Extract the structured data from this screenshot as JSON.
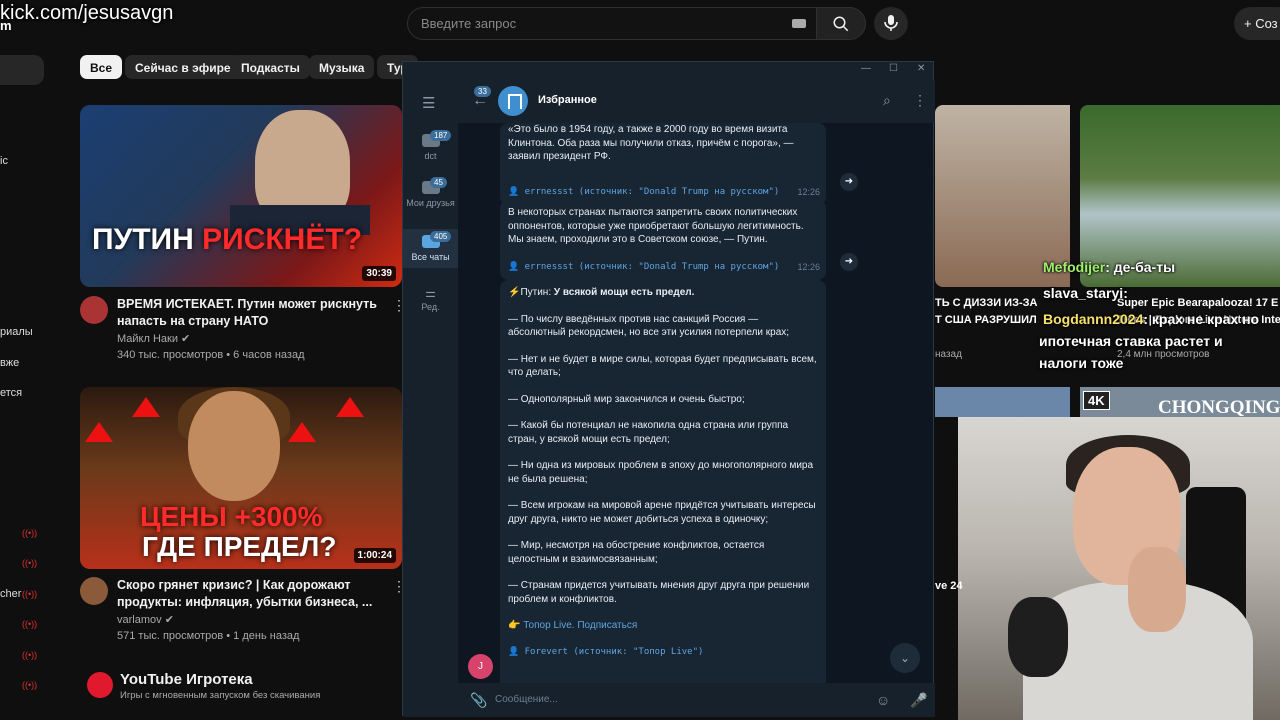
{
  "stream": {
    "url": "kick.com/jesusavgn",
    "url_cut": "m"
  },
  "youtube": {
    "search_placeholder": "Введите запрос",
    "create_label": "+ Соз",
    "chips": [
      "Все",
      "Сейчас в эфире",
      "Подкасты",
      "Музыка",
      "Тур"
    ],
    "sidebar_texts": [
      "ic",
      "риалы",
      "вже",
      "ется",
      "cher"
    ],
    "videos": [
      {
        "thumb_line1": "ПУТИН ",
        "thumb_line1_red": "РИСКНЁТ?",
        "duration": "30:39",
        "title": "ВРЕМЯ ИСТЕКАЕТ. Путин может рискнуть напасть на страну НАТО",
        "channel": "Майкл Наки",
        "meta": "340 тыс. просмотров • 6 часов назад"
      },
      {
        "thumb_line1_red": "ЦЕНЫ +300%",
        "thumb_line2": "ГДЕ ПРЕДЕЛ?",
        "duration": "1:00:24",
        "title": "Скоро грянет кризис? | Как дорожают продукты: инфляция, убытки бизнеса, ...",
        "channel": "varlamov",
        "meta": "571 тыс. просмотров • 1 день назад"
      }
    ],
    "right_cards": {
      "title_a": "ТЬ С ДИЗЗИ ИЗ-ЗА",
      "title_b": "Т США РАЗРУШИЛ",
      "meta_a": "назад",
      "title_c": "Super Epic Bearapalooza! 17 E",
      "title_d": "Trees | Explore Live Nature Inter",
      "meta_c": "2,4 млн просмотров",
      "caption_e": "ve 24",
      "badge": "4K",
      "caption_f": "CHONGQING"
    },
    "gamehub_title": "YouTube Игротека",
    "gamehub_sub": "Игры с мгновенным запуском без скачивания"
  },
  "chat_overlay": [
    {
      "user": "Mefodijer",
      "text": ": де-ба-ты"
    },
    {
      "user": "slava_staryi",
      "text": ":"
    },
    {
      "user": "Bogdannn2024",
      "text": ": крах не крах но"
    },
    {
      "user": "",
      "text": "ипотечная ставка растет и"
    },
    {
      "user": "",
      "text": "налоги тоже"
    }
  ],
  "telegram": {
    "chat_title": "Избранное",
    "unread_back": "33",
    "folders": [
      {
        "label": "dct",
        "badge": "187"
      },
      {
        "label": "Мои друзья",
        "badge": "45"
      },
      {
        "label": "Все чаты",
        "badge": "405"
      },
      {
        "label": "Ред.",
        "badge": ""
      }
    ],
    "msg1": {
      "text": "«Это было в 1954 году, а также в 2000 году во время визита Клинтона. Оба раза мы получили отказ, причём с порога», — заявил президент РФ.",
      "source": "👤 errnessst (источник: \"Donald Trump на русском\")",
      "time": "12:26"
    },
    "msg2": {
      "text": "В некоторых странах пытаются запретить своих политических оппонентов, которые уже приобретают большую легитимность. Мы знаем, проходили это в Советском союзе, — Путин.",
      "source": "👤 errnessst (источник: \"Donald Trump на русском\")",
      "time": "12:26"
    },
    "msg3": {
      "lead_icon": "⚡",
      "lead_prefix": "Путин: ",
      "lead_bold": "У всякой мощи есть предел.",
      "paragraphs": [
        "— По числу введённых против нас санкций Россия — абсолютный рекордсмен, но все эти усилия потерпели крах;",
        "— Нет и не будет в мире силы, которая будет предписывать всем, что делать;",
        "— Однополярный мир закончился и очень быстро;",
        "— Какой бы потенциал не накопила одна страна или группа стран, у всякой мощи есть предел;",
        "— Ни одна из мировых проблем в эпоху до многополярного мира не была решена;",
        "— Всем игрокам на мировой арене придётся учитывать интересы друг друга, никто не может добиться успеха в одиночку;",
        "— Мир, несмотря на обострение конфликтов, остается целостным и взаимосвязанным;",
        "— Странам придется учитывать мнения друг друга при решении проблем и конфликтов."
      ],
      "link_icon": "👉",
      "link": "Топор Live. Подписаться",
      "source": "👤 Forevert (источник: \"Топор Live\")",
      "sender_initial": "J"
    },
    "composer_placeholder": "Сообщение..."
  }
}
